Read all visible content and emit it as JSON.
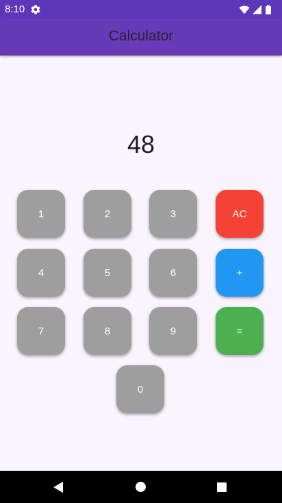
{
  "status_bar": {
    "time": "8:10",
    "icons": [
      "settings-icon",
      "wifi-icon",
      "signal-icon",
      "battery-icon"
    ]
  },
  "app_bar": {
    "title": "Calculator"
  },
  "display": {
    "value": "48"
  },
  "keypad": {
    "k1": "1",
    "k2": "2",
    "k3": "3",
    "ac": "AC",
    "k4": "4",
    "k5": "5",
    "k6": "6",
    "plus": "+",
    "k7": "7",
    "k8": "8",
    "k9": "9",
    "equals": "=",
    "k0": "0"
  },
  "colors": {
    "app_bar": "#673AB7",
    "status_bar": "#5E36B9",
    "digit_key": "#9E9E9E",
    "ac_key": "#F44336",
    "plus_key": "#2196F3",
    "equals_key": "#4CAF50",
    "background": "#F9F4FD"
  },
  "nav_bar": {
    "icons": [
      "back-icon",
      "home-icon",
      "recents-icon"
    ]
  }
}
